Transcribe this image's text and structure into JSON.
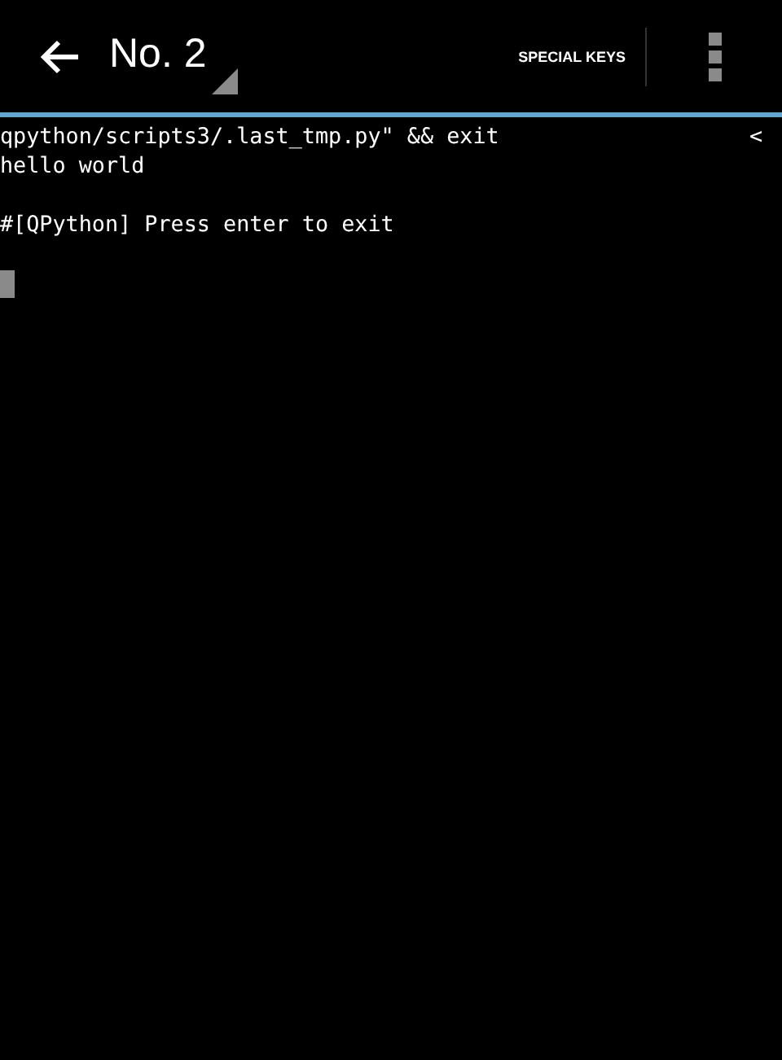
{
  "action_bar": {
    "title": "No. 2",
    "special_keys_label": "SPECIAL KEYS"
  },
  "terminal": {
    "blocks": [
      {
        "lines": [
          "qpython/scripts3/.last_tmp.py\" && exit",
          "hello world"
        ]
      },
      {
        "lines": [
          "#[QPython] Press enter to exit"
        ]
      }
    ],
    "scroll_marker": "<",
    "cursor_visible": true
  }
}
